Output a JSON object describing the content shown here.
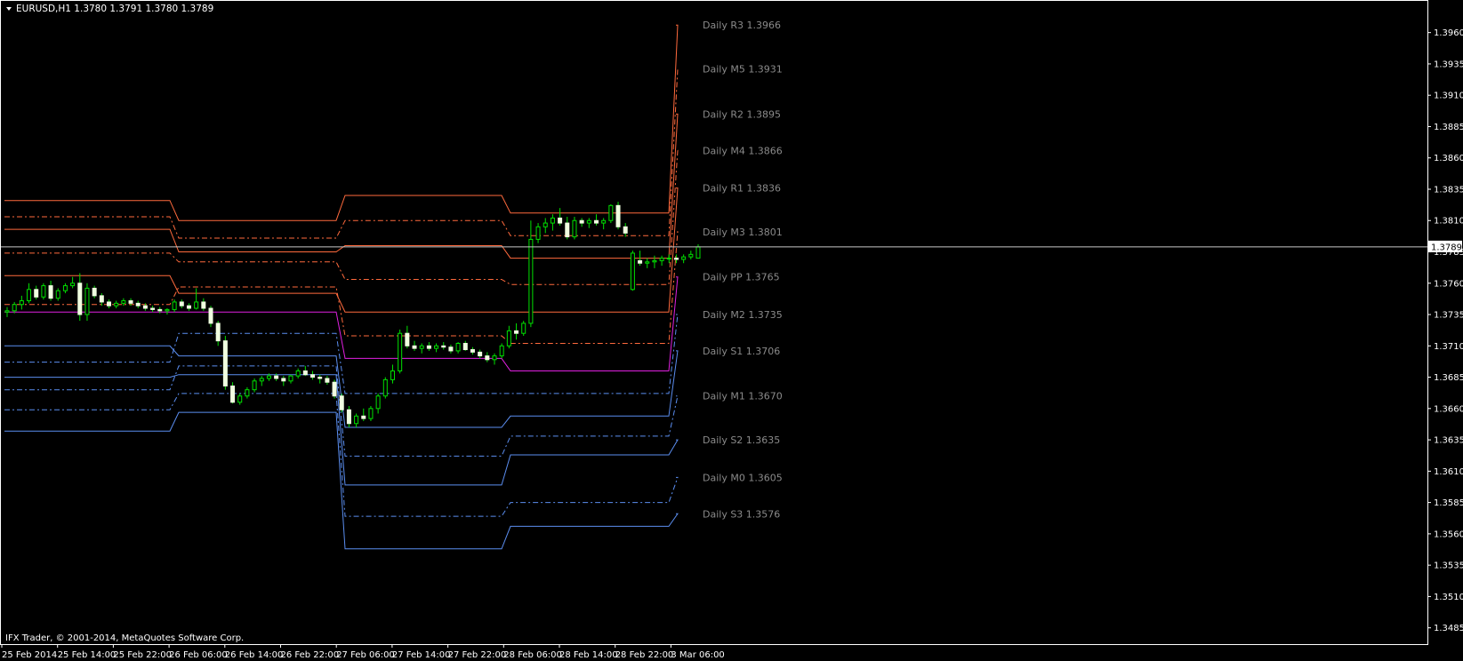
{
  "header": {
    "symbol_line": "EURUSD,H1  1.3780 1.3791 1.3780 1.3789"
  },
  "footer": {
    "copyright": "IFX Trader, © 2001-2014, MetaQuotes Software Corp."
  },
  "colors": {
    "background": "#000000",
    "axis": "#ffffff",
    "resistance": "#ff6a3d",
    "support": "#5b8ef0",
    "pivot": "#e020e0",
    "bull": "#00e000",
    "bear": "#f0ffe0",
    "label": "#8a8a8a"
  },
  "chart_data": {
    "type": "candlestick",
    "ylim": [
      1.3472,
      1.3986
    ],
    "y_ticks": [
      "1.3960",
      "1.3935",
      "1.3910",
      "1.3885",
      "1.3860",
      "1.3835",
      "1.3810",
      "1.3785",
      "1.3760",
      "1.3735",
      "1.3710",
      "1.3685",
      "1.3660",
      "1.3635",
      "1.3610",
      "1.3585",
      "1.3560",
      "1.3535",
      "1.3510",
      "1.3485"
    ],
    "x_ticks": [
      "25 Feb 2014",
      "25 Feb 14:00",
      "25 Feb 22:00",
      "26 Feb 06:00",
      "26 Feb 14:00",
      "26 Feb 22:00",
      "27 Feb 06:00",
      "27 Feb 14:00",
      "27 Feb 22:00",
      "28 Feb 06:00",
      "28 Feb 14:00",
      "28 Feb 22:00",
      "3 Mar 06:00"
    ],
    "current_price": 1.3789,
    "current_price_label": "1.3789",
    "pivot_days": [
      {
        "PP": 1.3737,
        "R1": 1.3766,
        "R2": 1.3803,
        "R3": 1.3826,
        "S1": 1.371,
        "S2": 1.3685,
        "S3": 1.3642,
        "M0": 1.3659,
        "M1": 1.3675,
        "M2": 1.3697,
        "M3": 1.3743,
        "M4": 1.3784,
        "M5": 1.3813
      },
      {
        "PP": 1.3737,
        "R1": 1.3752,
        "R2": 1.3785,
        "R3": 1.381,
        "S1": 1.3702,
        "S2": 1.3687,
        "S3": 1.3657,
        "M0": 1.3672,
        "M1": 1.3694,
        "M2": 1.372,
        "M3": 1.3757,
        "M4": 1.3777,
        "M5": 1.3796
      },
      {
        "PP": 1.37,
        "R1": 1.3737,
        "R2": 1.379,
        "R3": 1.383,
        "S1": 1.3645,
        "S2": 1.3599,
        "S3": 1.3548,
        "M0": 1.3574,
        "M1": 1.3622,
        "M2": 1.3672,
        "M3": 1.3718,
        "M4": 1.3763,
        "M5": 1.381
      },
      {
        "PP": 1.369,
        "R1": 1.3737,
        "R2": 1.378,
        "R3": 1.3816,
        "S1": 1.3654,
        "S2": 1.3623,
        "S3": 1.3566,
        "M0": 1.3585,
        "M1": 1.3638,
        "M2": 1.3672,
        "M3": 1.3712,
        "M4": 1.3759,
        "M5": 1.3798
      },
      {
        "PP": 1.3765,
        "R1": 1.3836,
        "R2": 1.3895,
        "R3": 1.3966,
        "S1": 1.3706,
        "S2": 1.3635,
        "S3": 1.3576,
        "M0": 1.3605,
        "M1": 1.367,
        "M2": 1.3735,
        "M3": 1.3801,
        "M4": 1.3866,
        "M5": 1.3931
      }
    ],
    "level_labels": [
      {
        "key": "R3",
        "text": "Daily R3 1.3966",
        "value": 1.3966
      },
      {
        "key": "M5",
        "text": "Daily M5 1.3931",
        "value": 1.3931
      },
      {
        "key": "R2",
        "text": "Daily R2 1.3895",
        "value": 1.3895
      },
      {
        "key": "M4",
        "text": "Daily M4 1.3866",
        "value": 1.3866
      },
      {
        "key": "R1",
        "text": "Daily R1 1.3836",
        "value": 1.3836
      },
      {
        "key": "M3",
        "text": "Daily M3 1.3801",
        "value": 1.3801
      },
      {
        "key": "PP",
        "text": "Daily PP 1.3765",
        "value": 1.3765
      },
      {
        "key": "M2",
        "text": "Daily M2 1.3735",
        "value": 1.3735
      },
      {
        "key": "S1",
        "text": "Daily S1 1.3706",
        "value": 1.3706
      },
      {
        "key": "M1",
        "text": "Daily M1 1.3670",
        "value": 1.367
      },
      {
        "key": "S2",
        "text": "Daily S2 1.3635",
        "value": 1.3635
      },
      {
        "key": "M0",
        "text": "Daily M0 1.3605",
        "value": 1.3605
      },
      {
        "key": "S3",
        "text": "Daily S3 1.3576",
        "value": 1.3576
      }
    ],
    "candles": [
      [
        1.3737,
        1.3741,
        1.3733,
        1.3738
      ],
      [
        1.3738,
        1.3745,
        1.3736,
        1.3743
      ],
      [
        1.3743,
        1.375,
        1.3739,
        1.3746
      ],
      [
        1.3746,
        1.376,
        1.3744,
        1.3755
      ],
      [
        1.3755,
        1.3758,
        1.3747,
        1.3749
      ],
      [
        1.3749,
        1.376,
        1.3747,
        1.3758
      ],
      [
        1.3758,
        1.3762,
        1.3746,
        1.3748
      ],
      [
        1.3748,
        1.3756,
        1.3746,
        1.3754
      ],
      [
        1.3754,
        1.376,
        1.3752,
        1.3758
      ],
      [
        1.3758,
        1.3765,
        1.3756,
        1.376
      ],
      [
        1.376,
        1.3768,
        1.373,
        1.3735
      ],
      [
        1.3735,
        1.376,
        1.373,
        1.3756
      ],
      [
        1.3756,
        1.3758,
        1.3748,
        1.375
      ],
      [
        1.375,
        1.3752,
        1.3742,
        1.3745
      ],
      [
        1.3745,
        1.3747,
        1.374,
        1.3742
      ],
      [
        1.3742,
        1.3746,
        1.374,
        1.3744
      ],
      [
        1.3744,
        1.3748,
        1.3742,
        1.3746
      ],
      [
        1.3746,
        1.3748,
        1.3742,
        1.3744
      ],
      [
        1.3744,
        1.3746,
        1.374,
        1.3742
      ],
      [
        1.3742,
        1.3744,
        1.3738,
        1.374
      ],
      [
        1.374,
        1.3742,
        1.3737,
        1.3739
      ],
      [
        1.3739,
        1.3741,
        1.3736,
        1.3738
      ],
      [
        1.3738,
        1.374,
        1.3735,
        1.3739
      ],
      [
        1.3739,
        1.3747,
        1.3737,
        1.3745
      ],
      [
        1.3745,
        1.3747,
        1.374,
        1.3742
      ],
      [
        1.3742,
        1.3744,
        1.3738,
        1.374
      ],
      [
        1.374,
        1.3756,
        1.3739,
        1.3745
      ],
      [
        1.3745,
        1.3748,
        1.3738,
        1.374
      ],
      [
        1.374,
        1.3742,
        1.3725,
        1.3728
      ],
      [
        1.3728,
        1.373,
        1.371,
        1.3714
      ],
      [
        1.3714,
        1.3718,
        1.3675,
        1.3678
      ],
      [
        1.3678,
        1.3681,
        1.3664,
        1.3665
      ],
      [
        1.3665,
        1.3672,
        1.3663,
        1.367
      ],
      [
        1.367,
        1.3677,
        1.3668,
        1.3675
      ],
      [
        1.3675,
        1.3684,
        1.3673,
        1.3682
      ],
      [
        1.3682,
        1.3686,
        1.3678,
        1.3684
      ],
      [
        1.3684,
        1.3688,
        1.3682,
        1.3686
      ],
      [
        1.3686,
        1.3688,
        1.3682,
        1.3684
      ],
      [
        1.3684,
        1.3686,
        1.3678,
        1.3682
      ],
      [
        1.3682,
        1.3687,
        1.368,
        1.3686
      ],
      [
        1.3686,
        1.3692,
        1.3684,
        1.369
      ],
      [
        1.369,
        1.3694,
        1.3686,
        1.3687
      ],
      [
        1.3687,
        1.369,
        1.3683,
        1.3685
      ],
      [
        1.3685,
        1.3687,
        1.368,
        1.3684
      ],
      [
        1.3684,
        1.3686,
        1.3679,
        1.3681
      ],
      [
        1.3681,
        1.3683,
        1.3668,
        1.367
      ],
      [
        1.367,
        1.3672,
        1.3657,
        1.3659
      ],
      [
        1.3659,
        1.3662,
        1.3645,
        1.3648
      ],
      [
        1.3648,
        1.3656,
        1.3645,
        1.3654
      ],
      [
        1.3654,
        1.366,
        1.365,
        1.3652
      ],
      [
        1.3652,
        1.3662,
        1.365,
        1.366
      ],
      [
        1.366,
        1.3672,
        1.3656,
        1.367
      ],
      [
        1.367,
        1.3685,
        1.3668,
        1.3683
      ],
      [
        1.3683,
        1.3695,
        1.368,
        1.369
      ],
      [
        1.369,
        1.3723,
        1.3688,
        1.372
      ],
      [
        1.372,
        1.3726,
        1.3708,
        1.371
      ],
      [
        1.371,
        1.3714,
        1.3706,
        1.3708
      ],
      [
        1.3708,
        1.3712,
        1.3704,
        1.371
      ],
      [
        1.371,
        1.3713,
        1.3706,
        1.3708
      ],
      [
        1.3708,
        1.3712,
        1.3705,
        1.371
      ],
      [
        1.371,
        1.3713,
        1.3707,
        1.3709
      ],
      [
        1.3709,
        1.3711,
        1.3704,
        1.3706
      ],
      [
        1.3706,
        1.3713,
        1.3704,
        1.3712
      ],
      [
        1.3712,
        1.3714,
        1.3706,
        1.3707
      ],
      [
        1.3707,
        1.3709,
        1.3703,
        1.3705
      ],
      [
        1.3705,
        1.3707,
        1.37,
        1.3702
      ],
      [
        1.3702,
        1.3705,
        1.3697,
        1.3699
      ],
      [
        1.3699,
        1.3704,
        1.3695,
        1.3702
      ],
      [
        1.3702,
        1.3712,
        1.37,
        1.371
      ],
      [
        1.371,
        1.3726,
        1.3708,
        1.3722
      ],
      [
        1.3722,
        1.3728,
        1.3715,
        1.372
      ],
      [
        1.372,
        1.373,
        1.3718,
        1.3728
      ],
      [
        1.3728,
        1.381,
        1.3725,
        1.3795
      ],
      [
        1.3795,
        1.3808,
        1.3792,
        1.3805
      ],
      [
        1.3805,
        1.3812,
        1.38,
        1.3808
      ],
      [
        1.3808,
        1.3815,
        1.3802,
        1.3812
      ],
      [
        1.3812,
        1.382,
        1.3806,
        1.3808
      ],
      [
        1.3808,
        1.3813,
        1.3795,
        1.3797
      ],
      [
        1.3797,
        1.3813,
        1.3795,
        1.381
      ],
      [
        1.381,
        1.3812,
        1.3805,
        1.3808
      ],
      [
        1.3808,
        1.3812,
        1.3804,
        1.381
      ],
      [
        1.381,
        1.3815,
        1.3806,
        1.3808
      ],
      [
        1.3808,
        1.3812,
        1.3803,
        1.381
      ],
      [
        1.381,
        1.3823,
        1.3808,
        1.3822
      ],
      [
        1.3822,
        1.3825,
        1.3803,
        1.3805
      ],
      [
        1.3805,
        1.3808,
        1.3797,
        1.38
      ],
      [
        1.3755,
        1.3786,
        1.3754,
        1.3784
      ],
      [
        1.3778,
        1.3786,
        1.3774,
        1.3776
      ],
      [
        1.3776,
        1.378,
        1.3772,
        1.3777
      ],
      [
        1.3777,
        1.3782,
        1.3772,
        1.3778
      ],
      [
        1.3778,
        1.3782,
        1.3774,
        1.378
      ],
      [
        1.378,
        1.3783,
        1.3776,
        1.378
      ],
      [
        1.378,
        1.3783,
        1.3776,
        1.3779
      ],
      [
        1.3779,
        1.3783,
        1.3776,
        1.3781
      ],
      [
        1.3781,
        1.3786,
        1.3779,
        1.3783
      ],
      [
        1.378,
        1.3791,
        1.378,
        1.3789
      ]
    ]
  }
}
